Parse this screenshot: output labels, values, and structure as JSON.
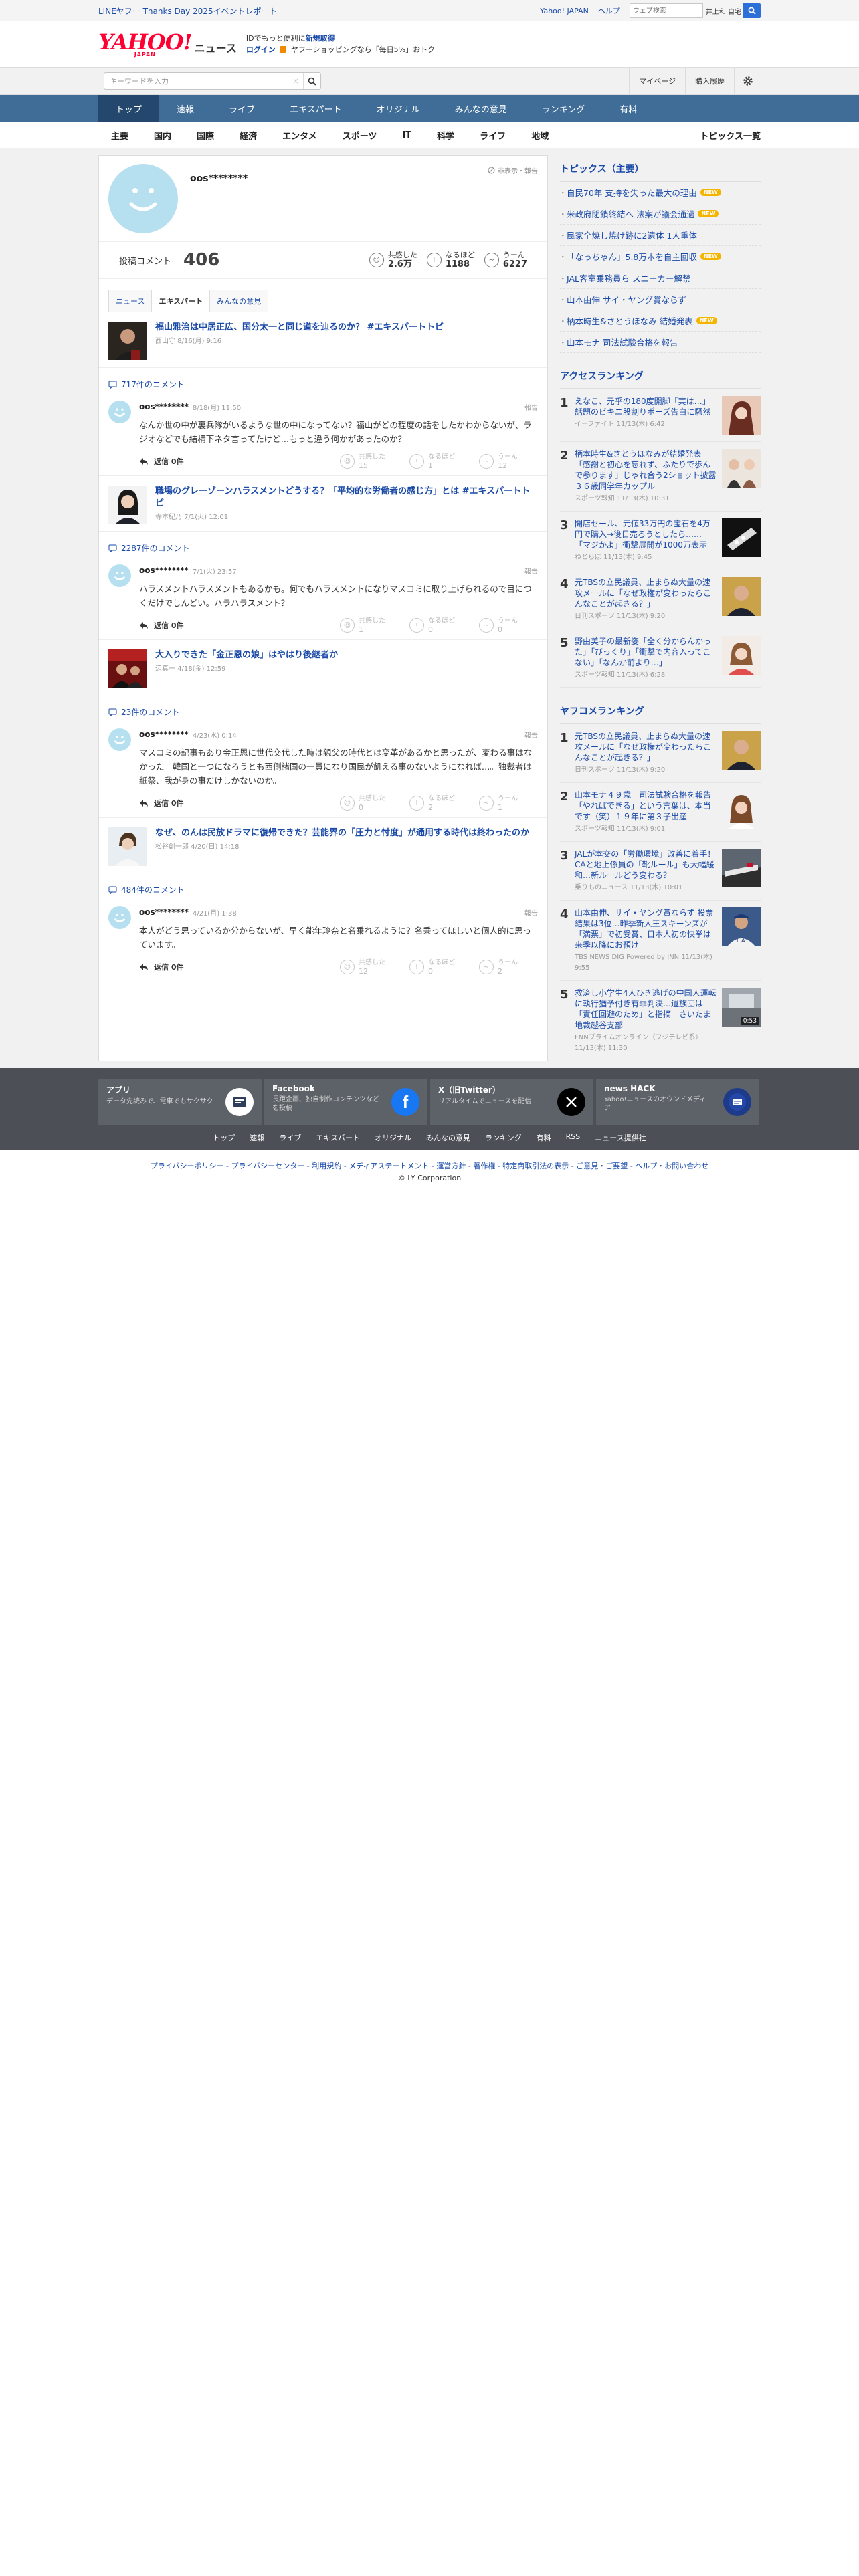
{
  "topbar": {
    "promo": "LINEヤフー Thanks Day 2025イベントレポート",
    "links": [
      "Yahoo! JAPAN",
      "ヘルプ"
    ],
    "search_placeholder": "ウェブ検索",
    "search_tag": "井上和 自宅"
  },
  "masthead": {
    "logo_main": "YAHOO!",
    "logo_sub": "JAPAN",
    "logo_news": "ニュース",
    "promo_line1_prefix": "IDでもっと便利に",
    "promo_line1_link": "新規取得",
    "promo_login": "ログイン",
    "promo_line2": "ヤフーショッピングなら「毎日5%」おトク"
  },
  "searchbar": {
    "placeholder": "キーワードを入力",
    "mypage": "マイページ",
    "history": "購入履歴"
  },
  "nav_primary": [
    "トップ",
    "速報",
    "ライブ",
    "エキスパート",
    "オリジナル",
    "みんなの意見",
    "ランキング",
    "有料"
  ],
  "nav_secondary": [
    "主要",
    "国内",
    "国際",
    "経済",
    "エンタメ",
    "スポーツ",
    "IT",
    "科学",
    "ライフ",
    "地域"
  ],
  "nav_secondary_right": "トピックス一覧",
  "profile": {
    "name": "oos********",
    "badge_link": "非表示・報告",
    "comment_label": "投稿コメント",
    "comment_count": "406",
    "reactions": [
      {
        "label": "共感した",
        "value": "2.6万"
      },
      {
        "label": "なるほど",
        "value": "1188"
      },
      {
        "label": "うーん",
        "value": "6227"
      }
    ]
  },
  "tabs": [
    "ニュース",
    "エキスパート",
    "みんなの意見"
  ],
  "threads": [
    {
      "title": "福山雅治は中居正広、国分太一と同じ道を辿るのか？ #エキスパートトピ",
      "meta": "西山守 8/16(月) 9:16",
      "comment_count": "717件のコメント",
      "comment": {
        "user": "oos********",
        "time": "8/18(月) 11:50",
        "report": "報告",
        "text": "なんか世の中が裏兵隊がいるような世の中になってない？福山がどの程度の話をしたかわからないが、ラジオなどでも結構下ネタ言ってたけど…もっと違う何かがあったのか？",
        "reply": "返信 0件",
        "votes": [
          {
            "l": "共感した",
            "v": "15"
          },
          {
            "l": "なるほど",
            "v": "1"
          },
          {
            "l": "うーん",
            "v": "12"
          }
        ]
      }
    },
    {
      "title": "職場のグレーゾーンハラスメントどうする？「平均的な労働者の感じ方」とは #エキスパートトピ",
      "meta": "寺本紀乃 7/1(火) 12:01",
      "comment_count": "2287件のコメント",
      "comment": {
        "user": "oos********",
        "time": "7/1(火) 23:57",
        "report": "報告",
        "text": "ハラスメントハラスメントもあるかも。何でもハラスメントになりマスコミに取り上げられるので目につくだけでしんどい。ハラハラスメント？",
        "reply": "返信 0件",
        "votes": [
          {
            "l": "共感した",
            "v": "1"
          },
          {
            "l": "なるほど",
            "v": "0"
          },
          {
            "l": "うーん",
            "v": "0"
          }
        ]
      }
    },
    {
      "title": "大入りできた「金正恩の娘」はやはり後継者か",
      "meta": "辺真一 4/18(金) 12:59",
      "comment_count": "23件のコメント",
      "comment": {
        "user": "oos********",
        "time": "4/23(水) 0:14",
        "report": "報告",
        "text": "マスコミの記事もあり金正恩に世代交代した時は親父の時代とは変革があるかと思ったが、変わる事はなかった。韓国と一つになろうとも西側諸国の一員になり国民が飢える事のないようになれば…。独裁者は紙祭、我が身の事だけしかないのか。",
        "reply": "返信 0件",
        "votes": [
          {
            "l": "共感した",
            "v": "0"
          },
          {
            "l": "なるほど",
            "v": "2"
          },
          {
            "l": "うーん",
            "v": "1"
          }
        ]
      }
    },
    {
      "title": "なぜ、のんは民放ドラマに復帰できた？芸能界の「圧力と忖度」が通用する時代は終わったのか",
      "meta": "松谷創一郎 4/20(日) 14:18",
      "comment_count": "484件のコメント",
      "comment": {
        "user": "oos********",
        "time": "4/21(月) 1:38",
        "report": "報告",
        "text": "本人がどう思っているか分からないが、早く能年玲奈と名乗れるように？名乗ってほしいと個人的に思っています。",
        "reply": "返信 0件",
        "votes": [
          {
            "l": "共感した",
            "v": "12"
          },
          {
            "l": "なるほど",
            "v": "0"
          },
          {
            "l": "うーん",
            "v": "2"
          }
        ]
      }
    }
  ],
  "sidebar": {
    "topics_heading": "トピックス（主要）",
    "topics": [
      {
        "t": "自民70年 支持を失った最大の理由",
        "new": true
      },
      {
        "t": "米政府閉鎖終結へ 法案が議会通過",
        "new": true
      },
      {
        "t": "民家全焼し焼け跡に2遺体 1人重体",
        "new": false
      },
      {
        "t": "「なっちゃん」5.8万本を自主回収",
        "new": true
      },
      {
        "t": "JAL客室乗務員ら スニーカー解禁",
        "new": false
      },
      {
        "t": "山本由伸 サイ・ヤング賞ならず",
        "new": false
      },
      {
        "t": "柄本時生&さとうほなみ 結婚発表",
        "new": true
      },
      {
        "t": "山本モナ 司法試験合格を報告",
        "new": false
      }
    ],
    "new_badge": "NEW",
    "access_heading": "アクセスランキング",
    "access": [
      {
        "n": "1",
        "t": "えなこ、元乎の180度開脚「実は…」話題のビキニ股割りポーズ告白に騒然",
        "s": "イーファイト 11/13(木) 6:42"
      },
      {
        "n": "2",
        "t": "柄本時生&さとうほなみが結婚発表「感謝と初心を忘れず、ふたりで歩んで参ります」じゃれ合う2ショット披露　３６歳同学年カップル",
        "s": "スポーツ報知 11/13(木) 10:31"
      },
      {
        "n": "3",
        "t": "開店セール、元値33万円の宝石を4万円で購入→後日売ろうとしたら……「マジかよ」衝撃展開が1000万表示",
        "s": "ねとらぼ 11/13(木) 9:45"
      },
      {
        "n": "4",
        "t": "元TBSの立民議員、止まらぬ大量の速攻メールに「なぜ政権が変わったらこんなことが起きる？」",
        "s": "日刊スポーツ 11/13(木) 9:20"
      },
      {
        "n": "5",
        "t": "野由美子の最新姿「全く分からんかった」「びっくり」「衝撃で内容入ってこない」「なんか前より…」",
        "s": "スポーツ報知 11/13(木) 6:28"
      }
    ],
    "yahoo_heading": "ヤフコメランキング",
    "yahoo": [
      {
        "n": "1",
        "t": "元TBSの立民議員、止まらぬ大量の速攻メールに「なぜ政権が変わったらこんなことが起きる？」",
        "s": "日刊スポーツ 11/13(木) 9:20"
      },
      {
        "n": "2",
        "t": "山本モナ４９歳　司法試験合格を報告「やればできる」という言葉は、本当です（笑）１９年に第３子出産",
        "s": "スポーツ報知 11/13(木) 9:01"
      },
      {
        "n": "3",
        "t": "JALが本交の「労働環境」改善に着手！ CAと地上係員の「靴ルール」も大幅緩和…新ルールどう変わる？",
        "s": "乗りものニュース 11/13(木) 10:01"
      },
      {
        "n": "4",
        "t": "山本由伸、サイ・ヤング賞ならず 投票結果は3位…昨季新人王スキーンズが「満票」で初受賞、日本人初の快挙は来季以降にお預け",
        "s": "TBS NEWS DIG Powered by JNN 11/13(木) 9:55"
      },
      {
        "n": "5",
        "t": "救済し小学生4人ひき逃げの中国人運転に執行猶予付き有罪判決…遺族団は「責任回避のため」と指摘　さいたま地裁越谷支部",
        "s": "FNNプライムオンライン（フジテレビ系） 11/13(木) 11:30",
        "badge": "0:53"
      }
    ]
  },
  "footer": {
    "cards": [
      {
        "title": "アプリ",
        "desc": "データ先読みで、電車でもサクサク"
      },
      {
        "title": "Facebook",
        "desc": "長距企画、独自制作コンテンツなどを投稿"
      },
      {
        "title": "X（旧Twitter）",
        "desc": "リアルタイムでニュースを配信"
      },
      {
        "title": "news HACK",
        "desc": "Yahoo!ニュースのオウンドメディア"
      }
    ],
    "links": [
      "トップ",
      "速報",
      "ライブ",
      "エキスパート",
      "オリジナル",
      "みんなの意見",
      "ランキング",
      "有料",
      "RSS",
      "ニュース提供社"
    ],
    "legal": "プライバシーポリシー - プライバシーセンター - 利用規約 - メディアステートメント - 運営方針 - 著作権 - 特定商取引法の表示 - ご意見・ご要望 - ヘルプ・お問い合わせ",
    "copyright": "© LY Corporation"
  },
  "colors": {
    "link": "#1a4aa8",
    "nav": "#3f6d97",
    "nav_active": "#24476d",
    "footer": "#4c5056",
    "yahoo_red": "#ff0033"
  }
}
